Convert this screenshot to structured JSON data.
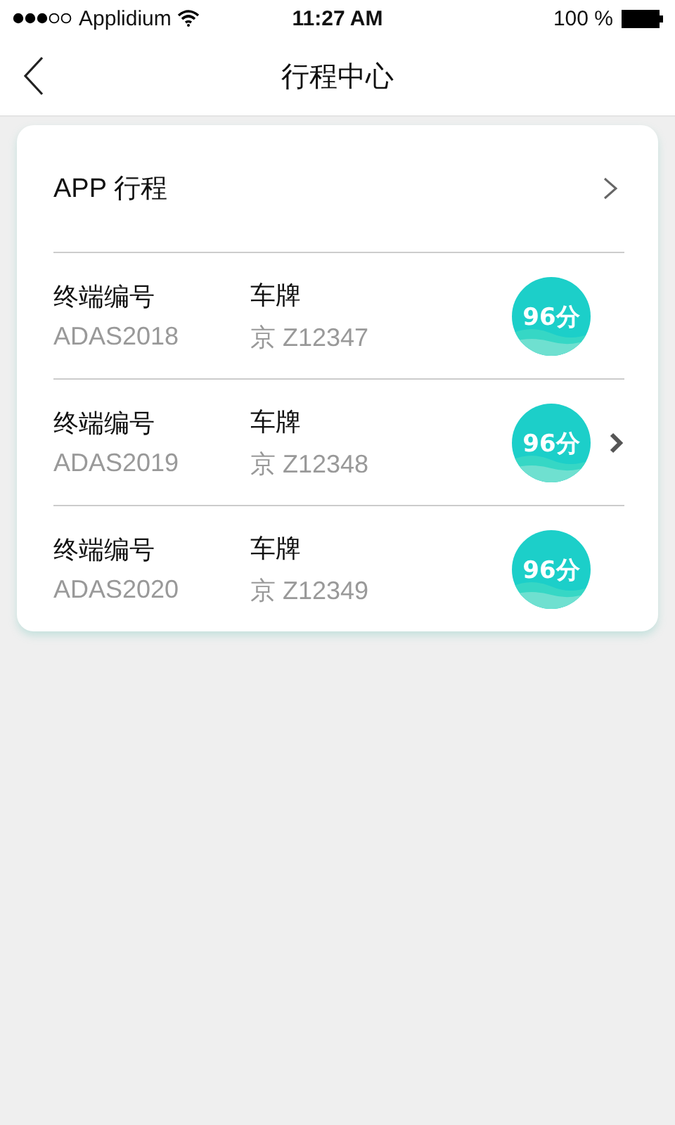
{
  "status_bar": {
    "carrier": "Applidium",
    "time": "11:27 AM",
    "battery": "100 %"
  },
  "nav": {
    "title": "行程中心"
  },
  "card": {
    "header": "APP 行程",
    "rows": [
      {
        "id_label": "终端编号",
        "id_value": "ADAS2018",
        "plate_label": "车牌",
        "plate_value": "京 Z12347",
        "score": "96分",
        "chevron": false
      },
      {
        "id_label": "终端编号",
        "id_value": "ADAS2019",
        "plate_label": "车牌",
        "plate_value": "京 Z12348",
        "score": "96分",
        "chevron": true
      },
      {
        "id_label": "终端编号",
        "id_value": "ADAS2020",
        "plate_label": "车牌",
        "plate_value": "京 Z12349",
        "score": "96分",
        "chevron": false
      }
    ]
  }
}
